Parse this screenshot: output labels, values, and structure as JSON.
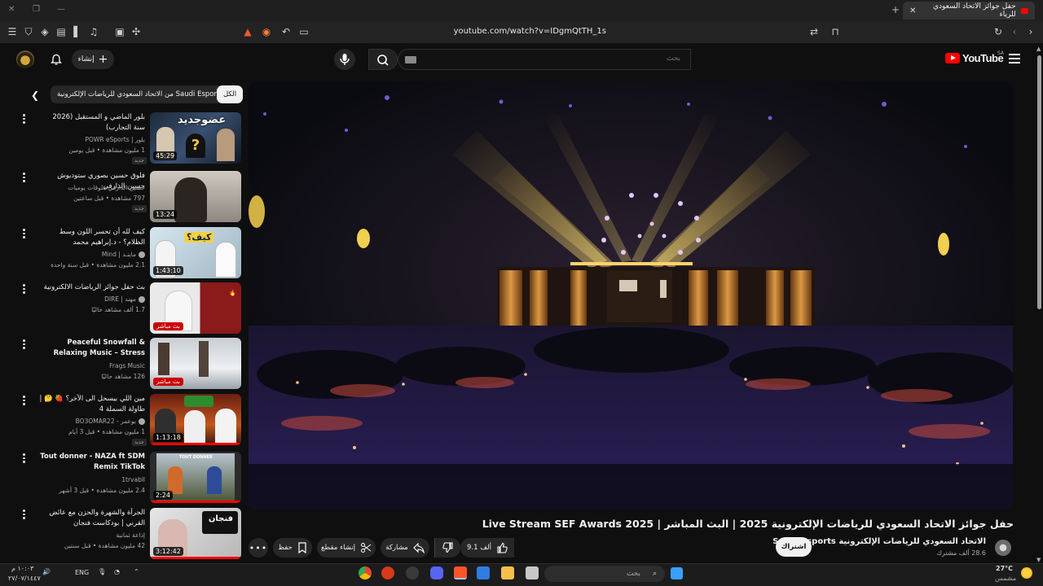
{
  "browser": {
    "tab_title": "حفل جوائز الاتحاد السعودي للرياء",
    "url": "youtube.com/watch?v=IDgmQtTH_1s"
  },
  "youtube": {
    "logo_text": "YouTube",
    "region": "SA",
    "search_placeholder": "بحث",
    "create_label": "إنشاء"
  },
  "video": {
    "title": "حفل جوائز الاتحاد السعودي للرياضات الإلكترونية 2025 | البث المباشر | Live Stream SEF Awards 2025",
    "channel_name": "الاتحاد السعودي للرياضات الإلكترونية Saudi Esports",
    "subscribers": "28.6 ألف مشترك",
    "subscribe_label": "اشتراك",
    "like_count": "9.1 ألف",
    "share_label": "مشاركة",
    "clip_label": "إنشاء مقطع",
    "save_label": "حفظ"
  },
  "chips": {
    "all": "الكل",
    "channel": "من الاتحاد السعودي للرياضات الإلكترونية Saudi Esports"
  },
  "recommendations": [
    {
      "title": "بلور الماضي و المستقبل (2026 سنة التجارب)",
      "channel": "بلور | POWR eSports",
      "stats": "1 مليون مشاهدة • قبل يومين",
      "duration": "45:29",
      "badge": "جديد",
      "thumb_text": "عضوجديد"
    },
    {
      "title": "فلوق حسين بصوري ستوديوش حسين الذارفي",
      "channel": "حسين الذارفي فلوقات يوميات",
      "stats": "797 مشاهدة • قبل ساعتين",
      "duration": "13:24",
      "badge": "جديد"
    },
    {
      "title": "كيف لله أن تحسر اللون وسط الظلام؟ - د.إبراهيم محمد",
      "channel": "ماينـد | Mind",
      "stats": "2.1 مليون مشاهدة • قبل سنة واحدة",
      "duration": "1:43:10",
      "thumb_text": "كيف؟"
    },
    {
      "title": "بث حفل جوائز الرياضات الالكترونية",
      "channel": "مهند | DIRE",
      "stats": "1.7 ألف مشاهد حاليًا",
      "live": "بث مباشر"
    },
    {
      "title": "Peaceful Snowfall & Relaxing Music – Stress Relief, ...",
      "channel": "Frags Music",
      "stats": "126 مشاهد حاليًا",
      "live": "بث مباشر"
    },
    {
      "title": "مين اللي بيسحل الى الآخر؟ 🍓 🤔 | طاولة السملة 4",
      "channel": "بوعمر - BO3OMAR22",
      "stats": "1 مليون مشاهدة • قبل 3 أيام",
      "duration": "1:13:18",
      "badge": "جديد"
    },
    {
      "title": "Tout donner - NAZA ft SDM Remix TikTok",
      "channel": "1trvabll",
      "stats": "2.4 مليون مشاهدة • قبل 3 أشهر",
      "duration": "2:24",
      "thumb_text": "TOUT DONNER"
    },
    {
      "title": "الجرأة والشهرة والحزن مع عائض القرني | بودكاست فنجان",
      "channel": "إذاعة ثمانية",
      "stats": "42 مليون مشاهدة • قبل سنتين",
      "duration": "3:12:42",
      "thumb_text": "فنجان"
    }
  ],
  "taskbar": {
    "search_placeholder": "بحث",
    "language": "ENG",
    "time": "١٠:٠٣ م",
    "date": "٢٧/٠٧/١٤٤٧",
    "temperature": "27°C",
    "weather": "مشمس"
  }
}
